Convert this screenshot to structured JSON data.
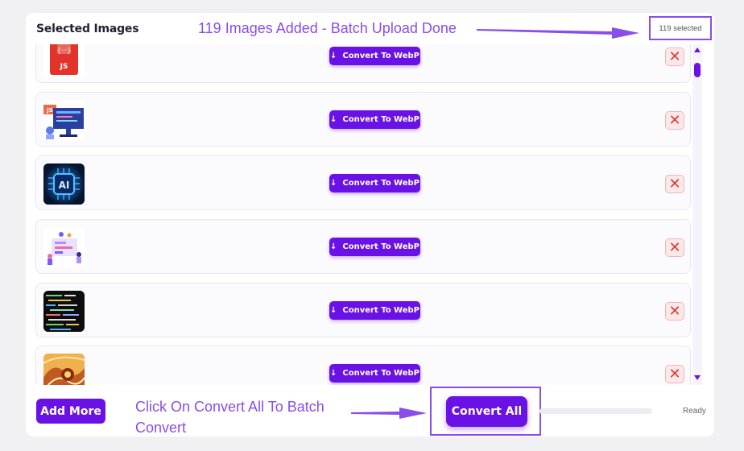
{
  "header": {
    "title": "Selected Images",
    "selected_count": "119 selected"
  },
  "annotations": {
    "top": "119 Images Added - Batch Upload Done",
    "bottom_line1": "Click On Convert All To Batch",
    "bottom_line2": "Convert",
    "color": "#8a4de8"
  },
  "rows": [
    {
      "thumb": "js-badge-icon",
      "convert_label": "Convert To WebP",
      "convert_icon": "↓",
      "remove_icon": "✕"
    },
    {
      "thumb": "js-desk-illustration",
      "convert_label": "Convert To WebP",
      "convert_icon": "↓",
      "remove_icon": "✕"
    },
    {
      "thumb": "ai-chip-icon",
      "convert_label": "Convert To WebP",
      "convert_icon": "↓",
      "remove_icon": "✕"
    },
    {
      "thumb": "team-dashboard-illustration",
      "convert_label": "Convert To WebP",
      "convert_icon": "↓",
      "remove_icon": "✕"
    },
    {
      "thumb": "code-screen-photo",
      "convert_label": "Convert To WebP",
      "convert_icon": "↓",
      "remove_icon": "✕"
    },
    {
      "thumb": "abstract-brain-art",
      "convert_label": "Convert To WebP",
      "convert_icon": "↓",
      "remove_icon": "✕"
    }
  ],
  "footer": {
    "add_more_label": "Add More",
    "convert_all_label": "Convert All",
    "status": "Ready",
    "progress": 0
  },
  "colors": {
    "accent": "#6a12e6",
    "remove_bg": "#fde8e8",
    "remove_fg": "#d63b3b"
  }
}
